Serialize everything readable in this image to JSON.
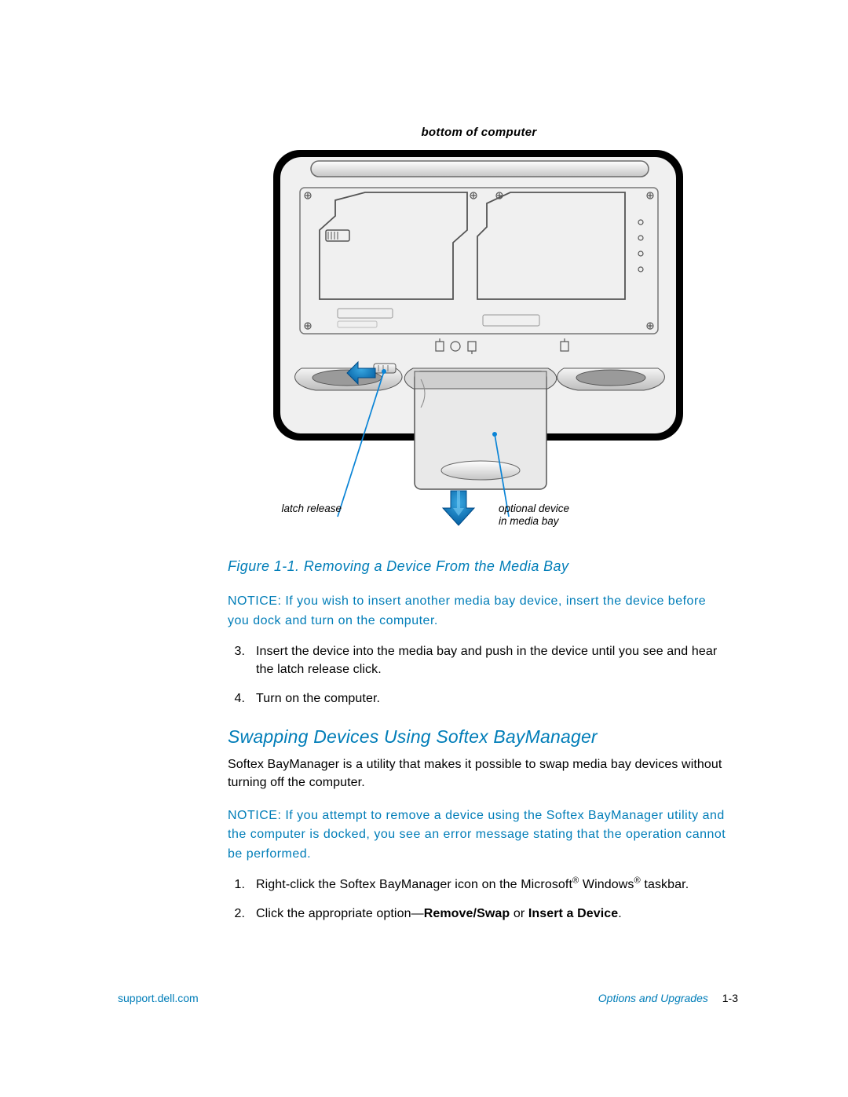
{
  "figure": {
    "top_label": "bottom of computer",
    "callout_left": "latch release",
    "callout_right": "optional device\nin media bay",
    "caption": "Figure 1-1.  Removing a Device From the Media Bay"
  },
  "notice1": "NOTICE: If you wish to insert another media bay device, insert the device before you dock and turn on the computer.",
  "steps_a": [
    {
      "num": "3.",
      "text": "Insert the device into the media bay and push in the device until you see and hear the latch release click."
    },
    {
      "num": "4.",
      "text": "Turn on the computer."
    }
  ],
  "section_heading": "Swapping Devices Using Softex BayManager",
  "intro_para": "Softex BayManager is a utility that makes it possible to swap media bay devices without turning off the computer.",
  "notice2": "NOTICE: If you attempt to remove a device using the Softex BayManager utility and the computer is docked, you see an error message stating that the operation cannot be performed.",
  "steps_b": [
    {
      "num": "1.",
      "html": "Right-click the Softex BayManager icon on the Microsoft<sup>®</sup> Windows<sup>®</sup> taskbar."
    },
    {
      "num": "2.",
      "html": "Click the appropriate option—<b>Remove/Swap</b> or <b>Insert a Device</b>."
    }
  ],
  "footer": {
    "left": "support.dell.com",
    "section": "Options and Upgrades",
    "pagenum": "1-3"
  },
  "colors": {
    "accent": "#007db8"
  }
}
